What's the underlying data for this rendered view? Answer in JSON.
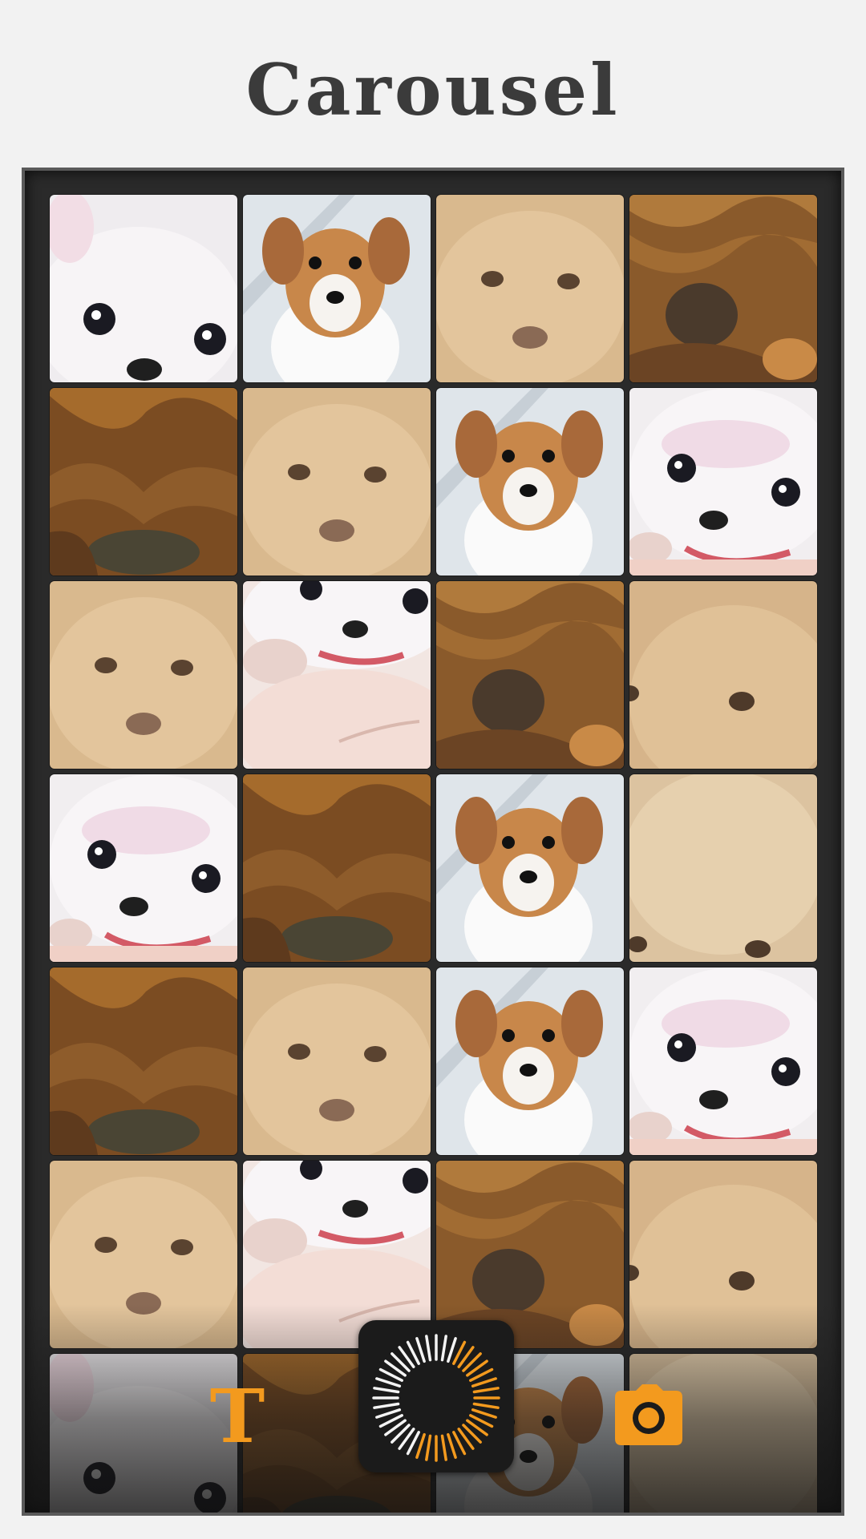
{
  "header": {
    "title": "Carousel"
  },
  "grid": {
    "rows": [
      [
        "white-puppy-eyes",
        "corgi-puppy",
        "fluffy-tan-puppy",
        "wrinkly-shar-pei"
      ],
      [
        "wrinkly-shar-pei-closeup",
        "fluffy-tan-puppy",
        "corgi-puppy",
        "white-puppy-paw"
      ],
      [
        "fluffy-tan-puppy",
        "white-puppy-hand",
        "wrinkly-shar-pei",
        "fluffy-tan-puppy-crop"
      ],
      [
        "white-puppy-paw",
        "wrinkly-shar-pei-closeup",
        "corgi-puppy",
        "fluffy-tan-puppy-top"
      ],
      [
        "wrinkly-shar-pei-closeup",
        "fluffy-tan-puppy",
        "corgi-puppy",
        "white-puppy-paw"
      ],
      [
        "fluffy-tan-puppy",
        "white-puppy-hand",
        "wrinkly-shar-pei",
        "fluffy-tan-puppy-crop"
      ],
      [
        "white-puppy-eyes",
        "wrinkly-shar-pei-closeup",
        "corgi-puppy",
        "fluffy-tan-puppy-top"
      ]
    ]
  },
  "toolbar": {
    "text_tool_glyph": "T",
    "text_tool_icon": "text-icon",
    "shutter_icon": "shutter-icon",
    "camera_icon": "camera-icon",
    "accent_color": "#f39a1e"
  },
  "colors": {
    "background": "#f2f2f2",
    "frame": "#2a2a2a",
    "title": "#3b3b3b"
  }
}
